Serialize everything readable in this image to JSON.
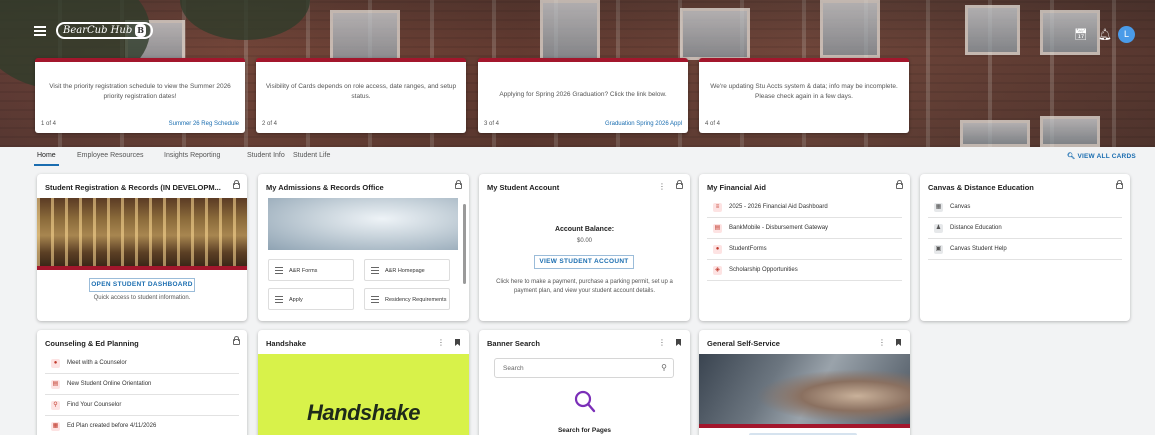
{
  "header": {
    "logo_text": "BearCub Hub",
    "logo_badge": "B",
    "icons": {
      "menu": "menu-icon",
      "calendar": "calendar-icon",
      "bell": "bell-icon"
    },
    "avatar_initial": "L",
    "avatar_color": "#4a9be8"
  },
  "notices": [
    {
      "message": "Visit the priority registration schedule to view the Summer 2026 priority registration dates!",
      "pager": "1 of 4",
      "link": "Summer 26 Reg Schedule"
    },
    {
      "message": "Visibility of Cards depends on role access, date ranges, and setup status.",
      "pager": "2 of 4",
      "link": ""
    },
    {
      "message": "Applying for Spring 2026 Graduation? Click the link below.",
      "pager": "3 of 4",
      "link": "Graduation Spring 2026 Appl"
    },
    {
      "message": "We're updating Stu Accts system & data; info may be incomplete. Please check again in a few days.",
      "pager": "4 of 4",
      "link": ""
    }
  ],
  "tabs": [
    "Home",
    "Employee Resources",
    "Insights Reporting",
    "Student Info",
    "Student Life"
  ],
  "view_all": "VIEW ALL CARDS",
  "cards": {
    "registration": {
      "title": "Student Registration & Records (IN DEVELOPM...",
      "button": "OPEN STUDENT DASHBOARD",
      "caption": "Quick access to student information."
    },
    "admissions": {
      "title": "My Admissions & Records Office",
      "tiles": [
        "A&R Forms",
        "A&R Homepage",
        "Apply",
        "Residency Requirements"
      ]
    },
    "account": {
      "title": "My Student Account",
      "balance_label": "Account Balance:",
      "balance_value": "$0.00",
      "button": "VIEW STUDENT ACCOUNT",
      "note": "Click here to make a payment, purchase a parking permit, set up a payment plan, and view your student account details."
    },
    "financial_aid": {
      "title": "My Financial Aid",
      "items": [
        "2025 - 2026 Financial Aid Dashboard",
        "BankMobile - Disbursement Gateway",
        "StudentForms",
        "Scholarship Opportunities"
      ]
    },
    "canvas": {
      "title": "Canvas & Distance Education",
      "items": [
        "Canvas",
        "Distance Education",
        "Canvas Student Help"
      ]
    },
    "counseling": {
      "title": "Counseling & Ed Planning",
      "items": [
        "Meet with a Counselor",
        "New Student Online Orientation",
        "Find Your Counselor",
        "Ed Plan created before 4/11/2026"
      ]
    },
    "handshake": {
      "title": "Handshake",
      "logo_text": "Handshake"
    },
    "banner": {
      "title": "Banner Search",
      "search_placeholder": "Search",
      "search_heading": "Search for Pages"
    },
    "self_service": {
      "title": "General Self-Service"
    }
  },
  "colors": {
    "accent": "#a3162c",
    "link": "#1a6db0",
    "handshake_bg": "#d8f24a",
    "search_icon": "#7b2fb8"
  }
}
